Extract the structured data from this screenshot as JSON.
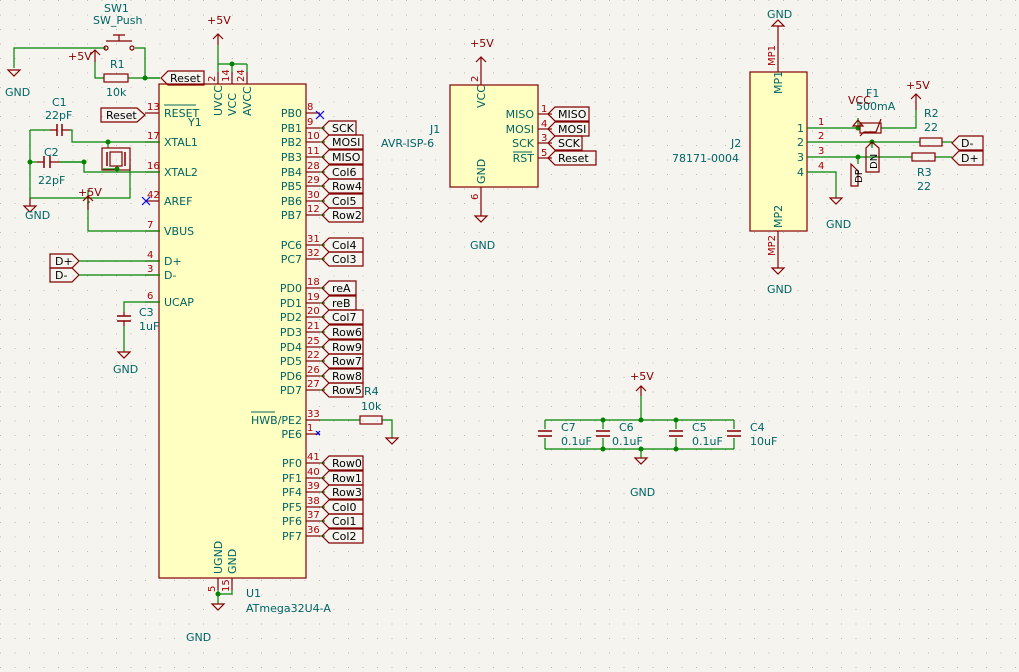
{
  "colors": {
    "background": "#f5f4ef",
    "grid": "#b9b9b9",
    "wire": "#008400",
    "body_fill": "#ffffc2",
    "body_stroke": "#840000",
    "label": "#006464",
    "pin": "#840000",
    "pin_num": "#a90000",
    "netlabel": "#840000",
    "noconnect": "#0000ff"
  },
  "power_labels": {
    "vcc": "+5V",
    "gnd": "GND",
    "vcc_flag": "VCC"
  },
  "sw1": {
    "ref": "SW1",
    "value": "SW_Push"
  },
  "r1": {
    "ref": "R1",
    "value": "10k"
  },
  "r2": {
    "ref": "R2",
    "value": "22"
  },
  "r3": {
    "ref": "R3",
    "value": "22"
  },
  "r4": {
    "ref": "R4",
    "value": "10k"
  },
  "c1": {
    "ref": "C1",
    "value": "22pF"
  },
  "c2": {
    "ref": "C2",
    "value": "22pF"
  },
  "c3": {
    "ref": "C3",
    "value": "1uF"
  },
  "c4": {
    "ref": "C4",
    "value": "10uF"
  },
  "c5": {
    "ref": "C5",
    "value": "0.1uF"
  },
  "c6": {
    "ref": "C6",
    "value": "0.1uF"
  },
  "c7": {
    "ref": "C7",
    "value": "0.1uF"
  },
  "y1": {
    "ref": "Y1"
  },
  "f1": {
    "ref": "F1",
    "value": "500mA"
  },
  "u1": {
    "ref": "U1",
    "value": "ATmega32U4-A",
    "left_pins": [
      {
        "num": "13",
        "name": "RESET"
      },
      {
        "num": "17",
        "name": "XTAL1"
      },
      {
        "num": "16",
        "name": "XTAL2"
      },
      {
        "num": "42",
        "name": "AREF"
      },
      {
        "num": "7",
        "name": "VBUS"
      },
      {
        "num": "4",
        "name": "D+"
      },
      {
        "num": "3",
        "name": "D-"
      },
      {
        "num": "6",
        "name": "UCAP"
      }
    ],
    "top_pins": [
      {
        "num": "2",
        "name": "UVCC"
      },
      {
        "num": "14",
        "name": "VCC"
      },
      {
        "num": "24",
        "name": "AVCC"
      }
    ],
    "bottom_pins": [
      {
        "num": "5",
        "name": "UGND"
      },
      {
        "num": "15",
        "name": "GND"
      }
    ],
    "right_pins": [
      {
        "num": "8",
        "name": "PB0",
        "net": ""
      },
      {
        "num": "9",
        "name": "PB1",
        "net": "SCK"
      },
      {
        "num": "10",
        "name": "PB2",
        "net": "MOSI"
      },
      {
        "num": "11",
        "name": "PB3",
        "net": "MISO"
      },
      {
        "num": "28",
        "name": "PB4",
        "net": "Col6"
      },
      {
        "num": "29",
        "name": "PB5",
        "net": "Row4"
      },
      {
        "num": "30",
        "name": "PB6",
        "net": "Col5"
      },
      {
        "num": "12",
        "name": "PB7",
        "net": "Row2"
      },
      {
        "num": "31",
        "name": "PC6",
        "net": "Col4"
      },
      {
        "num": "32",
        "name": "PC7",
        "net": "Col3"
      },
      {
        "num": "18",
        "name": "PD0",
        "net": "reA"
      },
      {
        "num": "19",
        "name": "PD1",
        "net": "reB"
      },
      {
        "num": "20",
        "name": "PD2",
        "net": "Col7"
      },
      {
        "num": "21",
        "name": "PD3",
        "net": "Row6"
      },
      {
        "num": "25",
        "name": "PD4",
        "net": "Row9"
      },
      {
        "num": "22",
        "name": "PD5",
        "net": "Row7"
      },
      {
        "num": "26",
        "name": "PD6",
        "net": "Row8"
      },
      {
        "num": "27",
        "name": "PD7",
        "net": "Row5"
      },
      {
        "num": "33",
        "name": "HWB/PE2",
        "net": ""
      },
      {
        "num": "1",
        "name": "PE6",
        "net": ""
      },
      {
        "num": "41",
        "name": "PF0",
        "net": "Row0"
      },
      {
        "num": "40",
        "name": "PF1",
        "net": "Row1"
      },
      {
        "num": "39",
        "name": "PF4",
        "net": "Row3"
      },
      {
        "num": "38",
        "name": "PF5",
        "net": "Col0"
      },
      {
        "num": "37",
        "name": "PF6",
        "net": "Col1"
      },
      {
        "num": "36",
        "name": "PF7",
        "net": "Col2"
      }
    ]
  },
  "j1": {
    "ref": "J1",
    "value": "AVR-ISP-6",
    "top_pin": {
      "num": "2",
      "name": "VCC"
    },
    "bottom_pin": {
      "num": "6",
      "name": "GND"
    },
    "right_pins": [
      {
        "num": "1",
        "name": "MISO",
        "net": "MISO"
      },
      {
        "num": "4",
        "name": "MOSI",
        "net": "MOSI"
      },
      {
        "num": "3",
        "name": "SCK",
        "net": "SCK"
      },
      {
        "num": "5",
        "name": "RST",
        "net": "Reset"
      }
    ]
  },
  "j2": {
    "ref": "J2",
    "value": "78171-0004",
    "top_pin": {
      "num": "MP1",
      "name": "MP1"
    },
    "bottom_pin": {
      "num": "MP2",
      "name": "MP2"
    },
    "pins": [
      "1",
      "2",
      "3",
      "4"
    ],
    "net_minus": "D-",
    "net_plus": "D+",
    "net_dp": "DP",
    "net_dn": "DN"
  },
  "netlabels": {
    "reset": "Reset",
    "dplus": "D+",
    "dminus": "D-"
  }
}
